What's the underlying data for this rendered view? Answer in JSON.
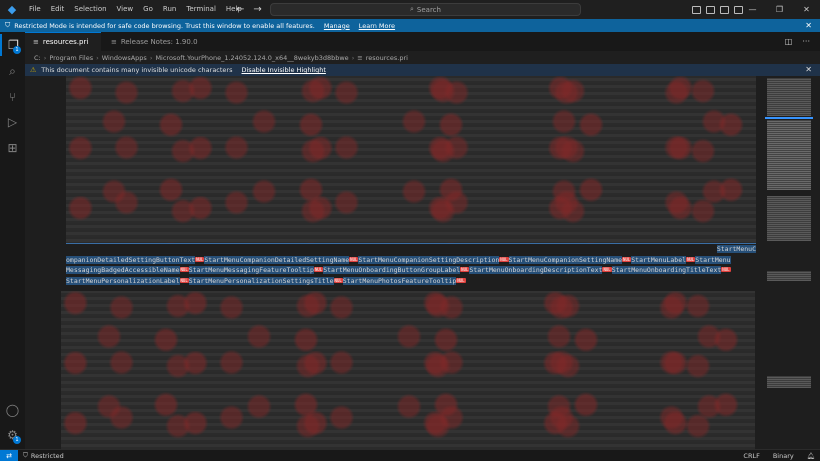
{
  "titlebar": {
    "menu": [
      "File",
      "Edit",
      "Selection",
      "View",
      "Go",
      "Run",
      "Terminal",
      "Help"
    ],
    "search_placeholder": "Search"
  },
  "banner": {
    "text": "Restricted Mode is intended for safe code browsing. Trust this window to enable all features.",
    "manage": "Manage",
    "learn_more": "Learn More"
  },
  "activity": {
    "badge_count": "1"
  },
  "tabs": [
    {
      "label": "resources.pri",
      "modified": true
    },
    {
      "label": "Release Notes: 1.90.0"
    }
  ],
  "breadcrumb": [
    "C:",
    "Program Files",
    "WindowsApps",
    "Microsoft.YourPhone_1.24052.124.0_x64__8wekyb3d8bbwe",
    "resources.pri"
  ],
  "warning": {
    "text": "This document contains many invisible unicode characters",
    "action": "Disable Invisible Highlight"
  },
  "editor": {
    "line0": "StartMenuC",
    "line1": [
      "ompanionDetailedSettingButtonText",
      "StartMenuCompanionDetailedSettingName",
      "StartMenuCompanionSettingDescription",
      "StartMenuCompanionSettingName",
      "StartMenuLabel",
      "StartMenu"
    ],
    "line2": [
      "MessagingBadgedAccessibleName",
      "StartMenuMessagingFeatureTooltip",
      "StartMenuOnboardingButtonGroupLabel",
      "StartMenuOnboardingDescriptionText",
      "StartMenuOnboardingTitleText"
    ],
    "line3": [
      "StartMenuPersonalizationLabel",
      "StartMenuPersonalizationSettingsTitle",
      "StartMenuPhotosFeatureTooltip"
    ],
    "control_char": "NUL"
  },
  "status": {
    "restricted": "Restricted",
    "eol": "CRLF",
    "encoding": "Binary"
  }
}
